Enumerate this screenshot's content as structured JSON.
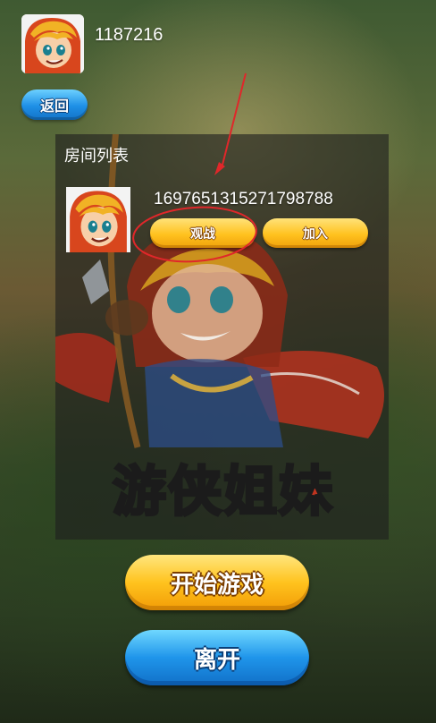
{
  "player": {
    "id": "1187216",
    "avatar_icon": "archer-girl-avatar-icon"
  },
  "back_label": "返回",
  "room_list": {
    "title": "房间列表",
    "rooms": [
      {
        "id": "1697651315271798788",
        "watch_label": "观战",
        "join_label": "加入",
        "avatar_icon": "archer-girl-avatar-icon"
      }
    ]
  },
  "logo": {
    "text_left": "游侠",
    "text_right": "姐妹"
  },
  "start_label": "开始游戏",
  "leave_label": "离开",
  "colors": {
    "yellow_button": "#ffc21f",
    "blue_button": "#1e8fe6",
    "annotation_red": "#e0272a",
    "panel_bg": "#1e1e1e"
  }
}
